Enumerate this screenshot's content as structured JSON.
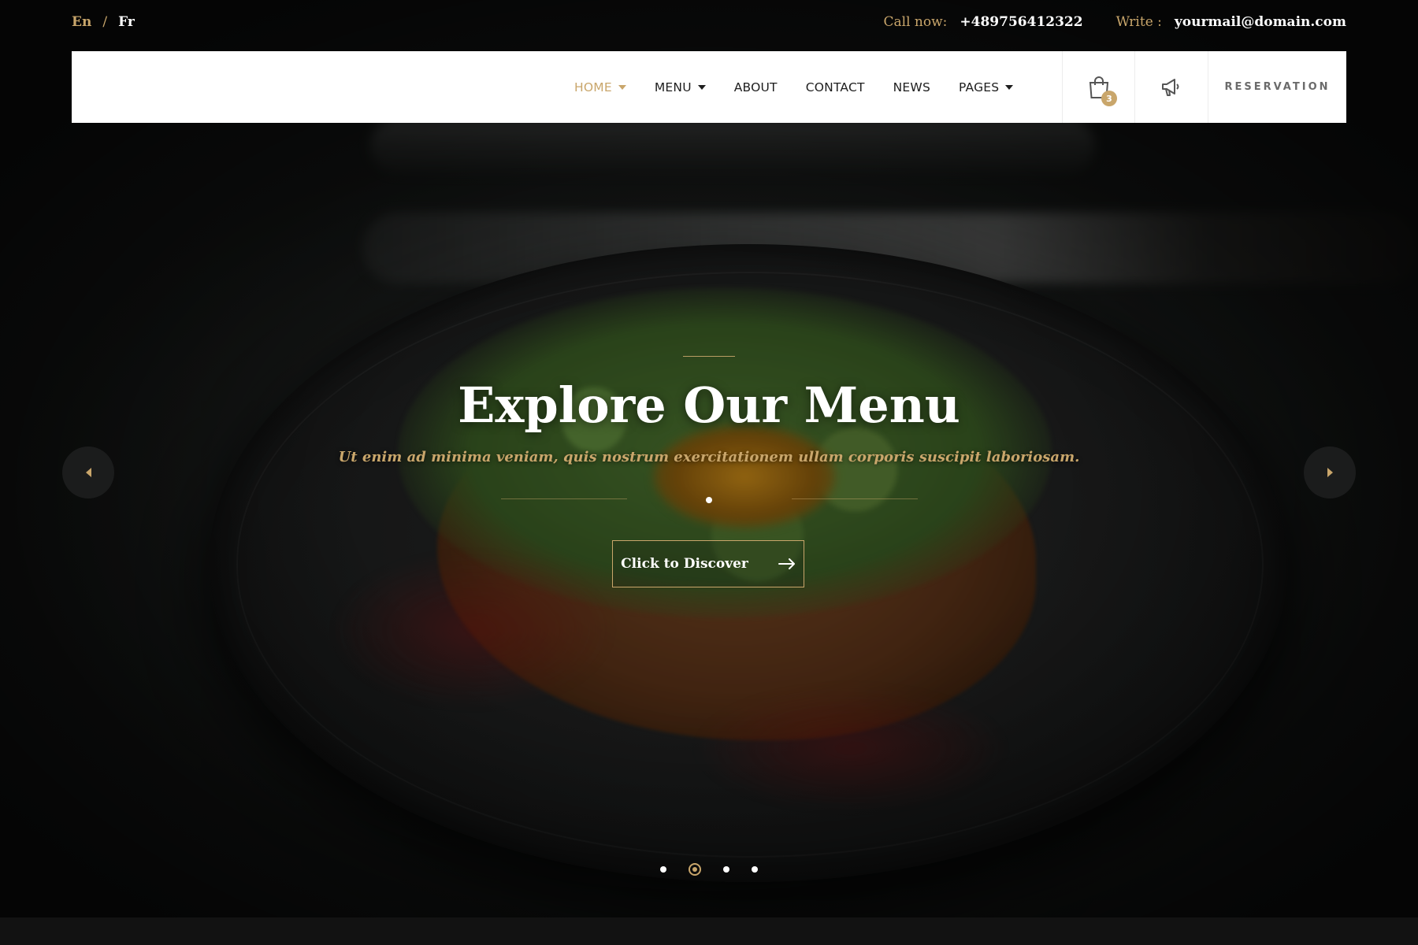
{
  "topbar": {
    "lang_en": "En",
    "lang_sep": "/",
    "lang_fr": "Fr",
    "call_label": "Call now:",
    "phone": "+489756412322",
    "write_label": "Write :",
    "email": "yourmail@domain.com"
  },
  "nav": {
    "items": [
      {
        "label": "HOME",
        "has_dropdown": true,
        "active": true
      },
      {
        "label": "MENU",
        "has_dropdown": true,
        "active": false
      },
      {
        "label": "ABOUT",
        "has_dropdown": false,
        "active": false
      },
      {
        "label": "CONTACT",
        "has_dropdown": false,
        "active": false
      },
      {
        "label": "NEWS",
        "has_dropdown": false,
        "active": false
      },
      {
        "label": "PAGES",
        "has_dropdown": true,
        "active": false
      }
    ],
    "cart_count": "3",
    "cart_icon": "shopping-bag-icon",
    "announce_icon": "megaphone-icon",
    "reservation_label": "RESERVATION"
  },
  "hero": {
    "title": "Explore Our Menu",
    "subtitle": "Ut enim ad minima veniam, quis nostrum exercitationem ullam corporis suscipit laboriosam.",
    "cta_label": "Click to Discover",
    "cta_icon": "arrow-right-icon",
    "prev_icon": "caret-left-icon",
    "next_icon": "caret-right-icon",
    "slide_count": 4,
    "active_slide": 2
  },
  "colors": {
    "accent": "#c9a66b",
    "navbar_bg": "#ffffff",
    "text_dark": "#1e1e1e"
  }
}
